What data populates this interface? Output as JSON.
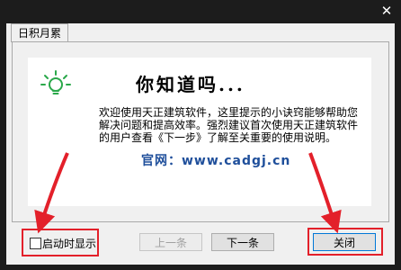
{
  "window": {
    "close_glyph": "✕"
  },
  "tab": {
    "label": "日积月累"
  },
  "content": {
    "heading": "你知道吗...",
    "tip_text": "欢迎使用天正建筑软件，这里提示的小诀窍能够帮助您解决问题和提高效率。强烈建议首次使用天正建筑软件的用户查看《下一步》了解至关重要的使用说明。",
    "watermark": "官网：www.cadgj.cn",
    "icon": "lightbulb-icon"
  },
  "footer": {
    "checkbox_label": "启动时显示",
    "checkbox_checked": false,
    "prev_label": "上一条",
    "next_label": "下一条",
    "close_label": "关闭"
  },
  "colors": {
    "annotation_red": "#e3202a",
    "bulb_green": "#2aa84a",
    "watermark_blue": "#1f4f9b",
    "chrome_dark": "#1c1c1c"
  }
}
